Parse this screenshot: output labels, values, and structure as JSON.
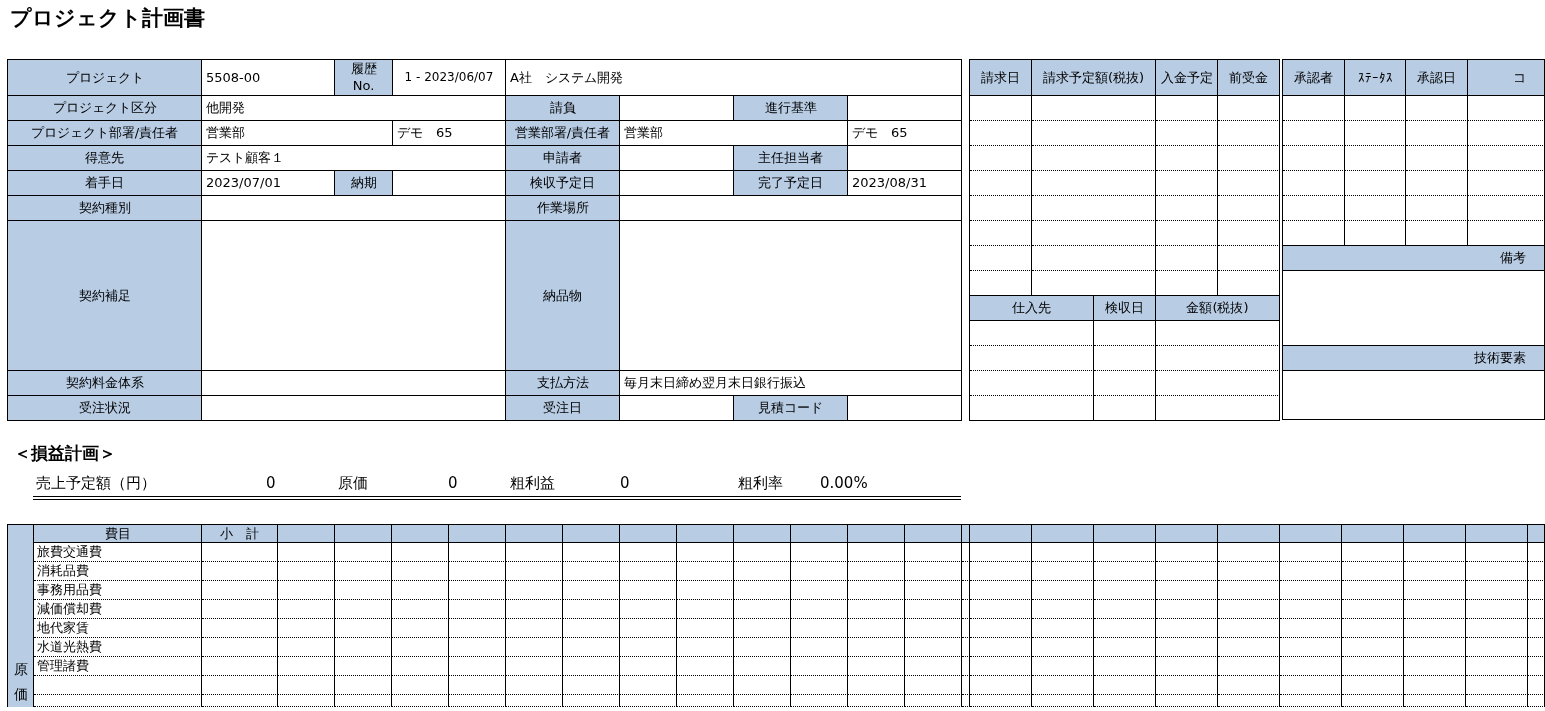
{
  "title": "プロジェクト計画書",
  "project_form": {
    "rows": [
      {
        "cells": [
          {
            "kind": "label",
            "text": "プロジェクト"
          },
          {
            "kind": "value",
            "text": "5508-00"
          },
          {
            "kind": "label",
            "text": "履歴 No."
          },
          {
            "kind": "centered",
            "text": "1 - 2023/06/07"
          },
          {
            "kind": "value",
            "text": "A社　システム開発",
            "colspan": 4
          }
        ]
      },
      {
        "cells": [
          {
            "kind": "label",
            "text": "プロジェクト区分"
          },
          {
            "kind": "value",
            "text": "他開発",
            "colspan": 3
          },
          {
            "kind": "label",
            "text": "請負"
          },
          {
            "kind": "value"
          },
          {
            "kind": "label",
            "text": "進行基準"
          },
          {
            "kind": "value"
          }
        ]
      },
      {
        "cells": [
          {
            "kind": "label",
            "text": "プロジェクト部署/責任者"
          },
          {
            "kind": "value",
            "text": "営業部",
            "colspan": 2
          },
          {
            "kind": "value",
            "text": "デモ　65"
          },
          {
            "kind": "label",
            "text": "営業部署/責任者"
          },
          {
            "kind": "value",
            "text": "営業部",
            "colspan": 2
          },
          {
            "kind": "value",
            "text": "デモ　65"
          }
        ]
      },
      {
        "cells": [
          {
            "kind": "label",
            "text": "得意先"
          },
          {
            "kind": "value",
            "text": "テスト顧客１",
            "colspan": 3
          },
          {
            "kind": "label",
            "text": "申請者"
          },
          {
            "kind": "value"
          },
          {
            "kind": "label",
            "text": "主任担当者"
          },
          {
            "kind": "value"
          }
        ]
      },
      {
        "cells": [
          {
            "kind": "label",
            "text": "着手日"
          },
          {
            "kind": "value",
            "text": "2023/07/01"
          },
          {
            "kind": "label",
            "text": "納期"
          },
          {
            "kind": "value"
          },
          {
            "kind": "label",
            "text": "検収予定日"
          },
          {
            "kind": "value"
          },
          {
            "kind": "label",
            "text": "完了予定日"
          },
          {
            "kind": "value",
            "text": "2023/08/31"
          }
        ]
      },
      {
        "cells": [
          {
            "kind": "label",
            "text": "契約種別"
          },
          {
            "kind": "value",
            "colspan": 3
          },
          {
            "kind": "label",
            "text": "作業場所"
          },
          {
            "kind": "value",
            "colspan": 3
          }
        ]
      },
      {
        "cells": [
          {
            "kind": "label",
            "text": "契約補足"
          },
          {
            "kind": "value",
            "colspan": 3
          },
          {
            "kind": "label",
            "text": "納品物"
          },
          {
            "kind": "value",
            "colspan": 3
          }
        ]
      },
      {
        "cells": [
          {
            "kind": "label",
            "text": "契約料金体系"
          },
          {
            "kind": "value",
            "colspan": 3
          },
          {
            "kind": "label",
            "text": "支払方法"
          },
          {
            "kind": "value",
            "text": "毎月末日締め翌月末日銀行振込",
            "colspan": 3
          }
        ]
      },
      {
        "cells": [
          {
            "kind": "label",
            "text": "受注状況"
          },
          {
            "kind": "value",
            "colspan": 3
          },
          {
            "kind": "label",
            "text": "受注日"
          },
          {
            "kind": "value"
          },
          {
            "kind": "label",
            "text": "見積コード"
          },
          {
            "kind": "value"
          }
        ]
      }
    ]
  },
  "billing_table": {
    "columns": [
      "請求日",
      "請求予定額(税抜)",
      "入金予定",
      "前受金"
    ]
  },
  "purchase_table": {
    "columns": [
      "仕入先",
      "検収日",
      "金額(税抜)"
    ]
  },
  "approval_table": {
    "columns": [
      "承認者",
      "ｽﾃｰﾀｽ",
      "承認日",
      "コ"
    ]
  },
  "notes": {
    "label": "備考"
  },
  "tech_elements": {
    "label": "技術要素"
  },
  "profit_plan": {
    "heading": "＜損益計画＞",
    "items": [
      {
        "label": "売上予定額（円）",
        "value": "0"
      },
      {
        "label": "原価",
        "value": "0"
      },
      {
        "label": "粗利益",
        "value": "0"
      },
      {
        "label": "粗利率",
        "value": "0.00%"
      }
    ]
  },
  "cost_table": {
    "side_label": "原価",
    "columns": [
      "費目",
      "小　計"
    ],
    "rows": [
      "旅費交通費",
      "消耗品費",
      "事務用品費",
      "減価償却費",
      "地代家賃",
      "水道光熱費",
      "管理諸費"
    ]
  }
}
